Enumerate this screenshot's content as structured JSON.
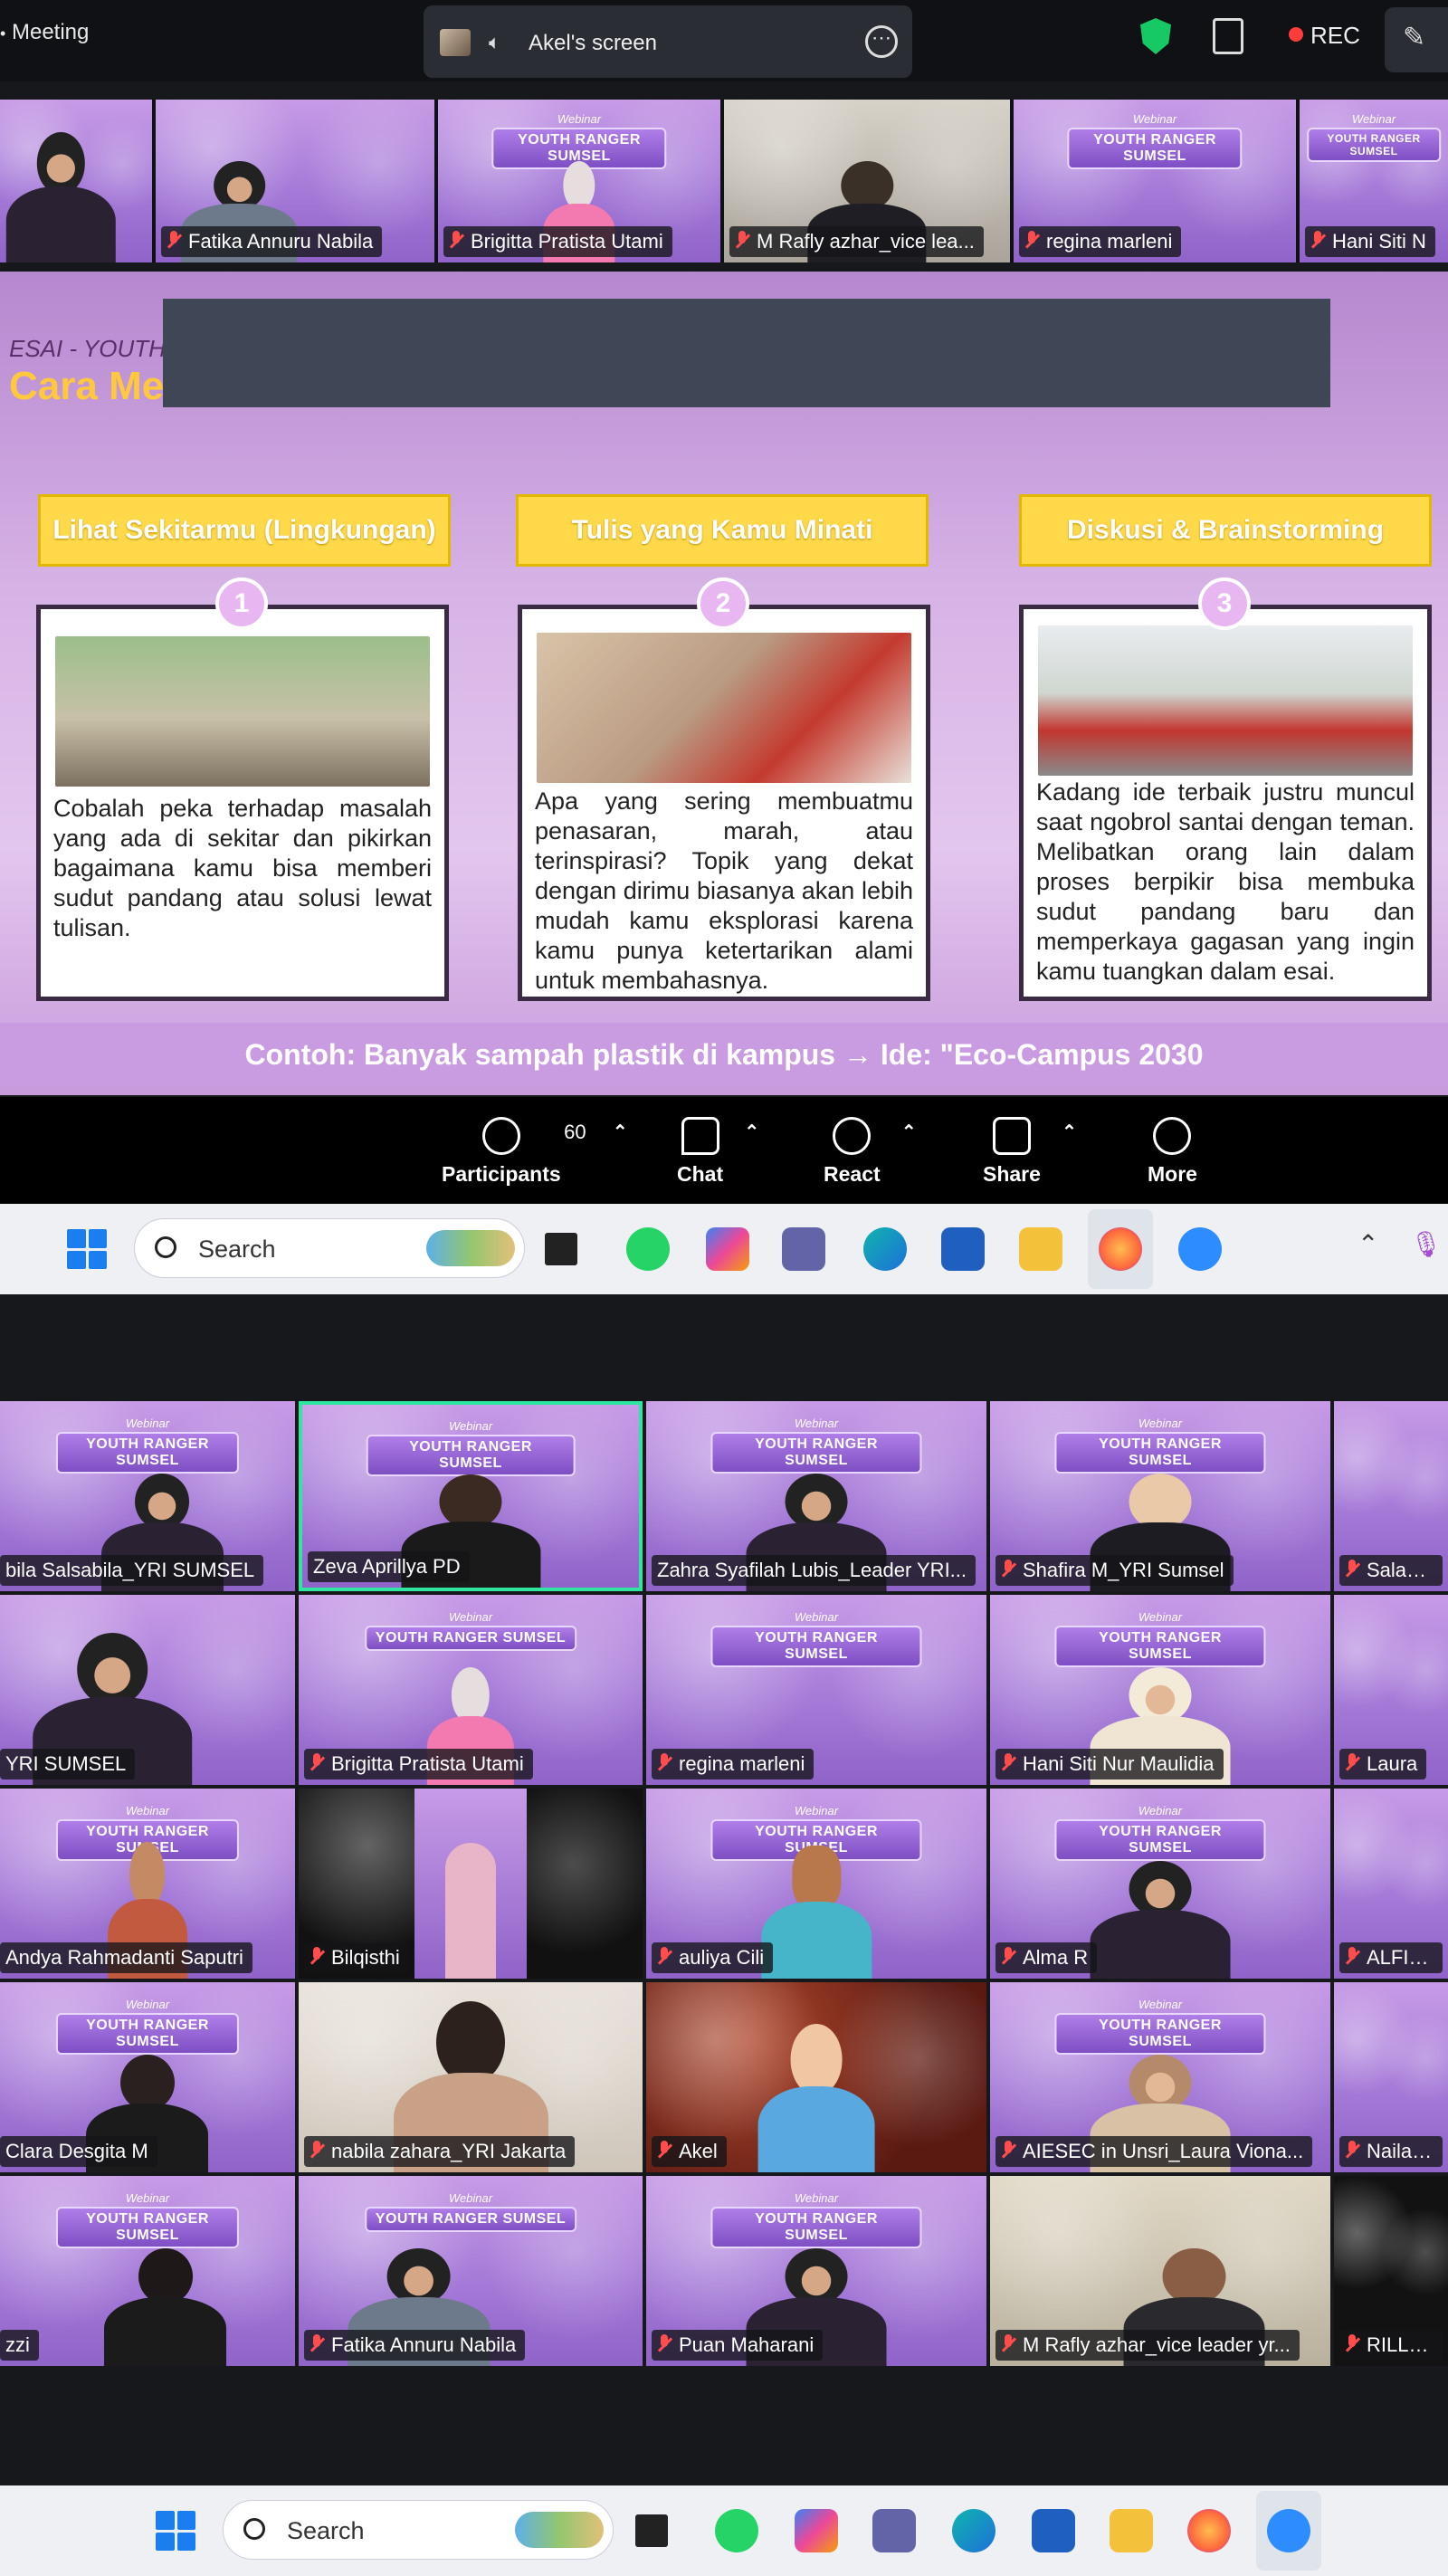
{
  "topbar": {
    "meeting_label": "Meeting",
    "share_tab_label": "Akel's screen",
    "rec_label": "REC",
    "colors": {
      "shield": "#17c964",
      "rec_dot": "#ff3b3b"
    }
  },
  "strip": {
    "tiles": [
      {
        "name": ""
      },
      {
        "name": "Fatika Annuru Nabila"
      },
      {
        "name": "Brigitta Pratista Utami"
      },
      {
        "name": "M Rafly azhar_vice lea..."
      },
      {
        "name": "regina marleni"
      },
      {
        "name": "Hani Siti N"
      }
    ]
  },
  "banner": {
    "webinar": "Webinar",
    "title": "YOUTH RANGER SUMSEL"
  },
  "slide": {
    "subtitle": "ESAI - YOUTH",
    "title": "Cara Me",
    "columns": [
      {
        "header": "Lihat Sekitarmu (Lingkungan)",
        "number": "1",
        "text": "Cobalah peka terhadap masalah yang ada di sekitar dan pikirkan bagaimana kamu bisa memberi sudut pandang atau solusi lewat tulisan."
      },
      {
        "header": "Tulis yang Kamu Minati",
        "number": "2",
        "text": "Apa yang sering membuatmu penasaran, marah, atau terinspirasi? Topik yang dekat dengan dirimu biasanya akan lebih mudah kamu eksplorasi karena kamu punya ketertarikan alami untuk membahasnya."
      },
      {
        "header": "Diskusi & Brainstorming",
        "number": "3",
        "text": "Kadang ide terbaik justru muncul saat ngobrol santai dengan teman. Melibatkan orang lain dalam proses berpikir bisa membuka sudut pandang baru dan memperkaya gagasan yang ingin kamu tuangkan dalam esai."
      }
    ],
    "footer": "Contoh: Banyak sampah plastik di kampus → Ide: \"Eco-Campus 2030"
  },
  "controls": {
    "participants_label": "Participants",
    "participants_count": "60",
    "chat_label": "Chat",
    "react_label": "React",
    "share_label": "Share",
    "more_label": "More"
  },
  "taskbar": {
    "search_placeholder": "Search"
  },
  "gallery": {
    "rows": [
      [
        "bila Salsabila_YRI SUMSEL",
        "Zeva Aprillya PD",
        "Zahra Syafilah Lubis_Leader YRI...",
        "Shafira M_YRI Sumsel",
        "Salasatu"
      ],
      [
        "YRI SUMSEL",
        "Brigitta Pratista Utami",
        "regina marleni",
        "Hani Siti Nur Maulidia",
        "Laura"
      ],
      [
        "Andya Rahmadanti Saputri",
        "Bilqisthi",
        "auliya Cili",
        "Alma R",
        "ALFIATU"
      ],
      [
        "Clara Desgita M",
        "nabila zahara_YRI Jakarta",
        "Akel",
        "AIESEC in Unsri_Laura Viona...",
        "Nailah_"
      ],
      [
        "zzi",
        "Fatika Annuru Nabila",
        "Puan Maharani",
        "M Rafly azhar_vice leader yr...",
        "RILLAH"
      ]
    ],
    "active_speaker": "Zeva Aprillya PD",
    "active_color": "#2ee6a0"
  }
}
